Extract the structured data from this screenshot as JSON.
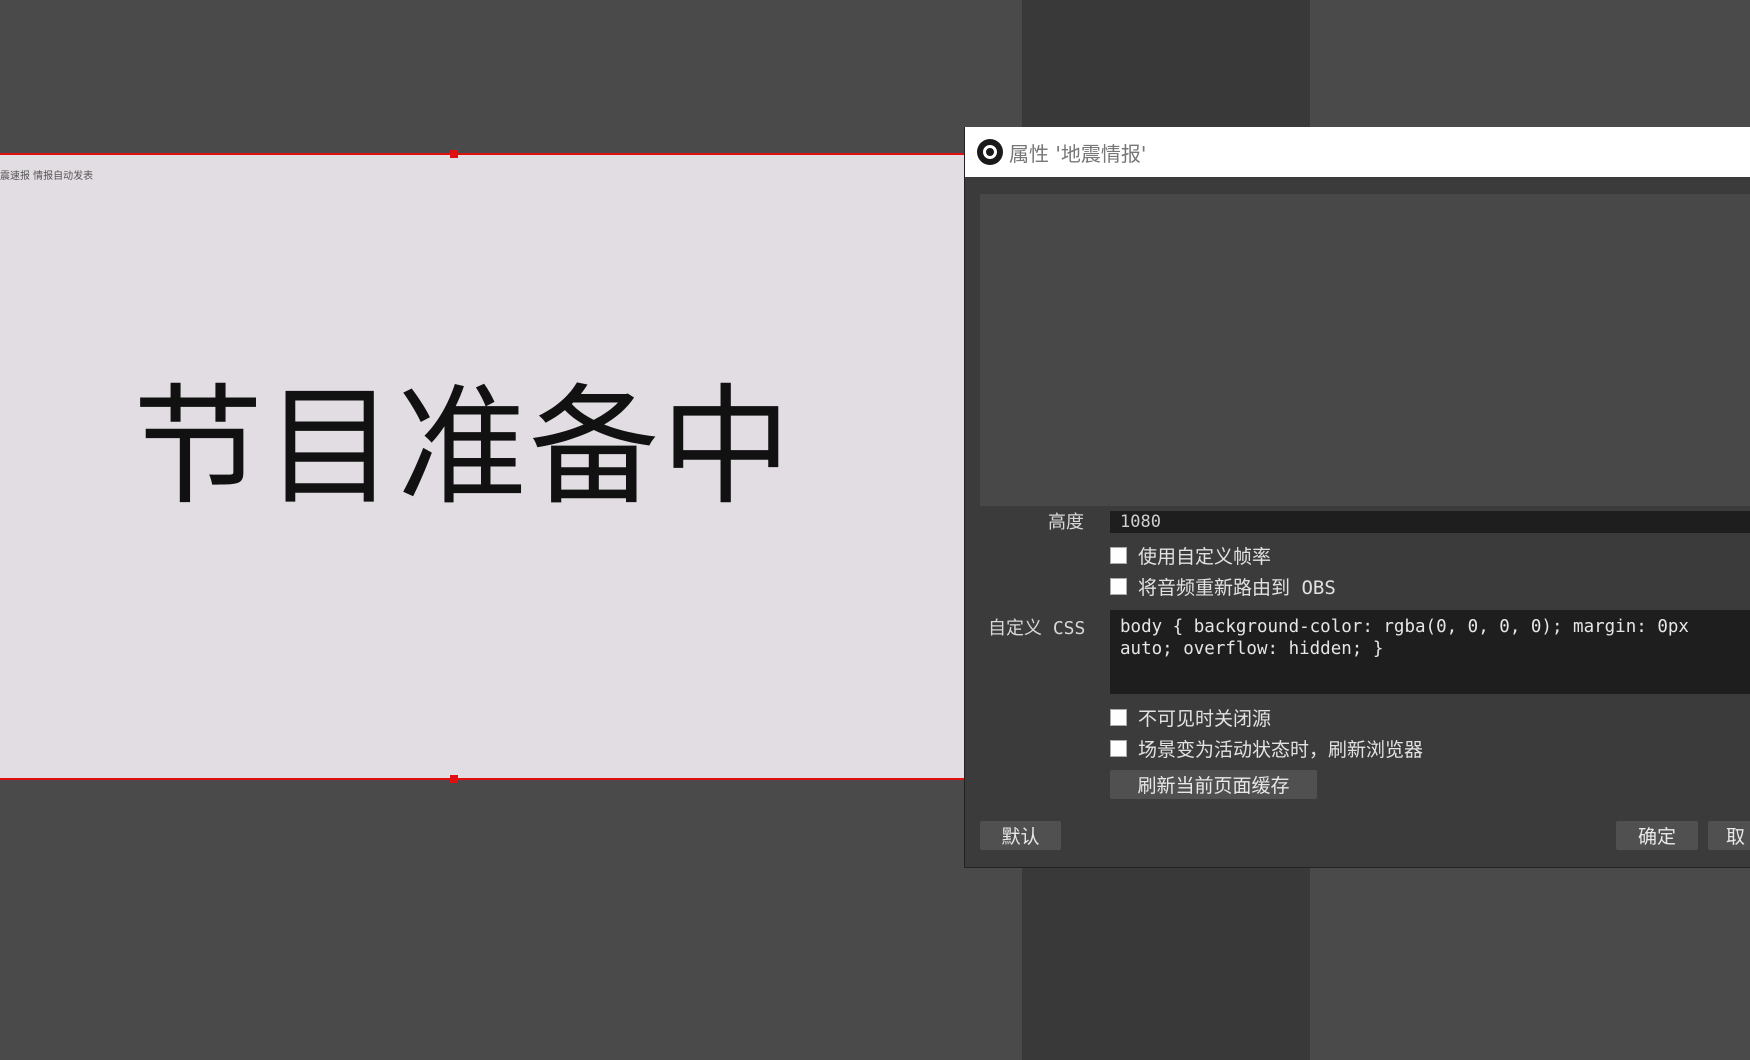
{
  "preview": {
    "caption": "震速报 情报自动发表",
    "big_text": "节目准备中"
  },
  "dialog": {
    "title": "属性 '地震情报'",
    "height_label": "高度",
    "height_value": "1080",
    "checkboxes": [
      {
        "label": "使用自定义帧率",
        "checked": false
      },
      {
        "label": "将音频重新路由到 OBS",
        "checked": false
      },
      {
        "label": "不可见时关闭源",
        "checked": false
      },
      {
        "label": "场景变为活动状态时，刷新浏览器",
        "checked": false
      }
    ],
    "css_label": "自定义 CSS",
    "css_value": "body { background-color: rgba(0, 0, 0, 0); margin: 0px auto; overflow: hidden; }",
    "refresh_button": "刷新当前页面缓存",
    "default_button": "默认",
    "ok_button": "确定",
    "cancel_button": "取"
  },
  "colors": {
    "selection_border": "#e01010",
    "dialog_bg": "#3b3b3b",
    "canvas_bg": "#4a4a4a"
  }
}
